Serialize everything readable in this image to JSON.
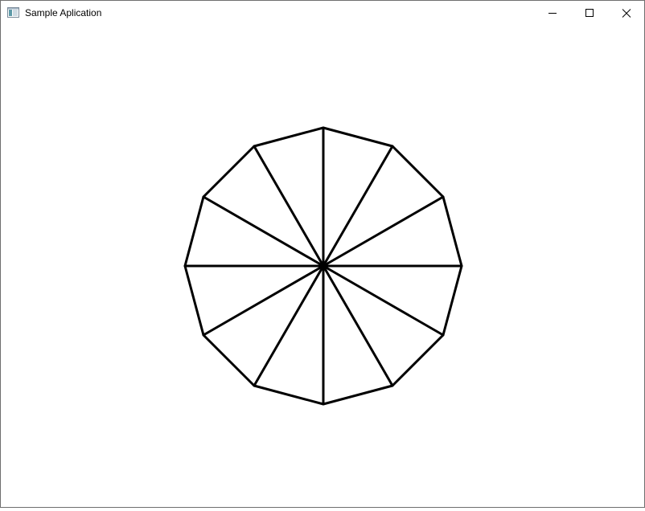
{
  "window": {
    "title": "Sample Aplication"
  },
  "titlebar": {
    "icons": {
      "app": "app-window-icon",
      "minimize": "minimize-icon",
      "maximize": "maximize-icon",
      "close": "close-icon"
    }
  },
  "canvas": {
    "shape": "dodecagon",
    "sides": 12,
    "stroke_color": "#000000",
    "fill_color": "#ffffff",
    "spokes": 12
  }
}
